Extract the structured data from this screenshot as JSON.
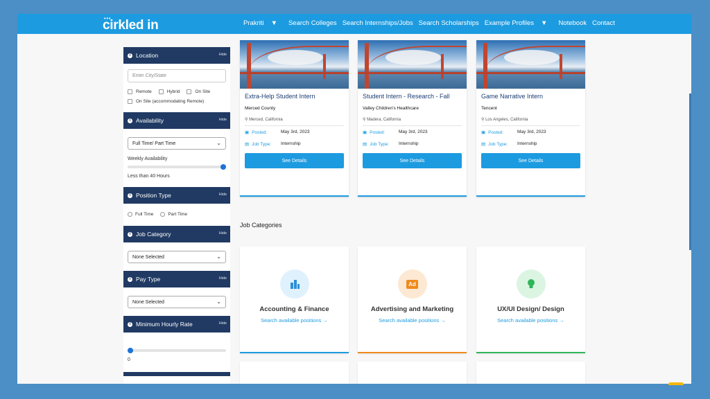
{
  "brand": {
    "logo": "cirkled in"
  },
  "nav": [
    "Prakriti",
    "Search Colleges",
    "Search Internships/Jobs",
    "Search Scholarships",
    "Example Profiles",
    "Notebook",
    "Contact"
  ],
  "sidebar": {
    "hide_label": "Hide",
    "location": {
      "title": "Location",
      "placeholder": "Enter City/State",
      "options": [
        "Remote",
        "Hybrid",
        "On Site",
        "On Site (accommodating Remote)"
      ]
    },
    "availability": {
      "title": "Availability",
      "selected": "Full Time/ Part Time",
      "weekly_label": "Weekly Availability",
      "slider_fraction": 1.0,
      "value_text": "Less than 40 Hours"
    },
    "position_type": {
      "title": "Position Type",
      "options": [
        "Full Time",
        "Part Time"
      ]
    },
    "job_category": {
      "title": "Job Category",
      "selected": "None Selected"
    },
    "pay_type": {
      "title": "Pay Type",
      "selected": "None Selected"
    },
    "min_rate": {
      "title": "Minimum Hourly Rate",
      "slider_fraction": 0.0,
      "value": "0"
    }
  },
  "cards": [
    {
      "title": "Extra-Help Student Intern",
      "company": "Merced County",
      "location": "Merced, California",
      "posted_label": "Posted:",
      "posted": "May 3rd, 2023",
      "jobtype_label": "Job Type:",
      "jobtype": "Internship",
      "button": "See Details"
    },
    {
      "title": "Student Intern - Research - Fall",
      "company": "Valley Children's Healthcare",
      "location": "Madera, California",
      "posted_label": "Posted:",
      "posted": "May 3rd, 2023",
      "jobtype_label": "Job Type:",
      "jobtype": "Internship",
      "button": "See Details"
    },
    {
      "title": "Game Narrative Intern",
      "company": "Tencent",
      "location": "Los Angeles, California",
      "posted_label": "Posted:",
      "posted": "May 3rd, 2023",
      "jobtype_label": "Job Type:",
      "jobtype": "Internship",
      "button": "See Details"
    }
  ],
  "job_categories": {
    "title": "Job Categories",
    "items": [
      {
        "name": "Accounting & Finance",
        "link": "Search available positions →",
        "icon": "building-icon",
        "icon_color": "#2d8fd8",
        "icon_bg": "#dff1fd",
        "bar_color": "#1d9be0"
      },
      {
        "name": "Advertising and Marketing",
        "link": "Search available positions →",
        "icon_text": "Ad",
        "icon_color": "#f08a1c",
        "icon_bg": "#fde8d3",
        "bar_color": "#f08a1c"
      },
      {
        "name": "UX/UI Design/ Design",
        "link": "Search available positions →",
        "icon": "lightbulb-icon",
        "icon_color": "#2fb65a",
        "icon_bg": "#dcf5e3",
        "bar_color": "#2fb65a"
      }
    ]
  }
}
